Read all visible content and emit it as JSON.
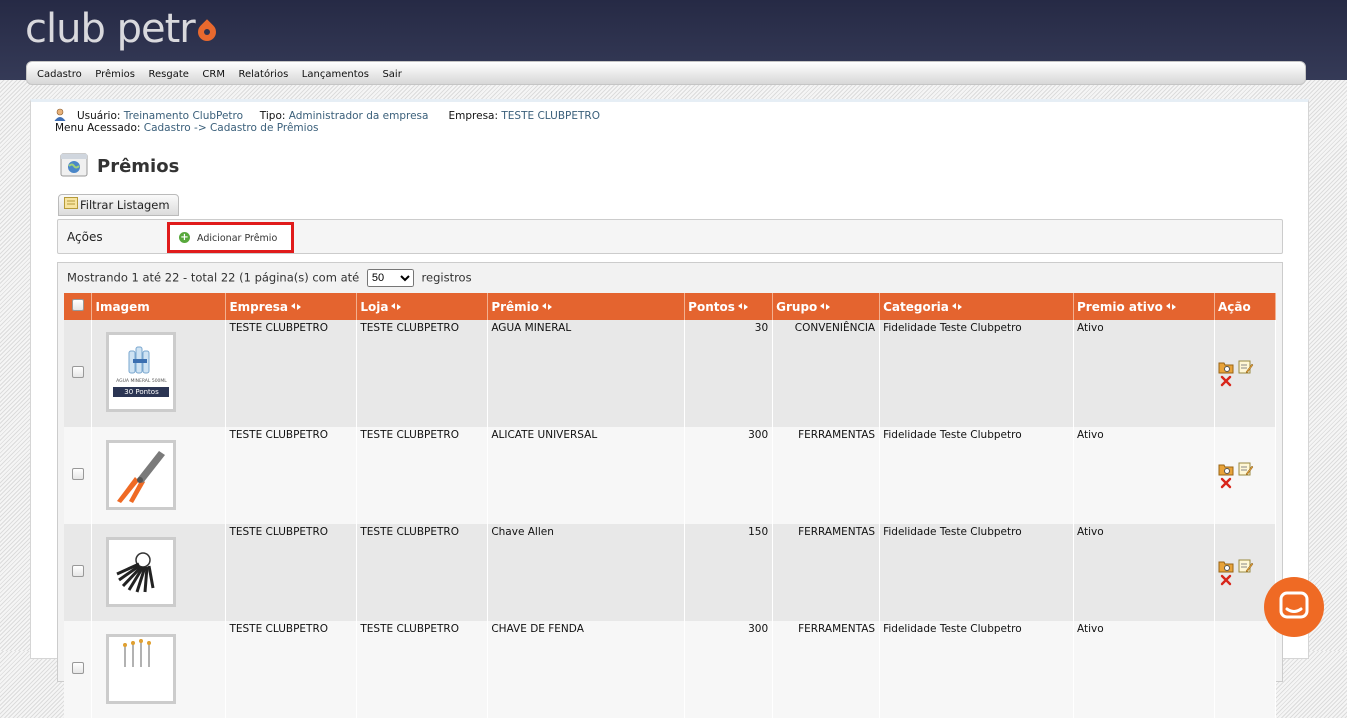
{
  "logo": {
    "text": "club petr"
  },
  "menu": [
    {
      "label": "Cadastro"
    },
    {
      "label": "Prêmios"
    },
    {
      "label": "Resgate"
    },
    {
      "label": "CRM"
    },
    {
      "label": "Relatórios"
    },
    {
      "label": "Lançamentos"
    },
    {
      "label": "Sair"
    }
  ],
  "userinfo": {
    "usuario_label": "Usuário:",
    "usuario": "Treinamento ClubPetro",
    "tipo_label": "Tipo:",
    "tipo": "Administrador da empresa",
    "empresa_label": "Empresa:",
    "empresa": "TESTE CLUBPETRO",
    "menu_label": "Menu Acessado:",
    "menu_path": "Cadastro -> Cadastro de Prêmios"
  },
  "page": {
    "title": "Prêmios",
    "filter_button": "Filtrar Listagem",
    "actions_label": "Ações",
    "add_button": "Adicionar Prêmio"
  },
  "listing": {
    "showing_text": "Mostrando 1 até 22 - total 22 (1 página(s) com até",
    "page_size": "50",
    "suffix": "registros"
  },
  "table": {
    "headers": {
      "imagem": "Imagem",
      "empresa": "Empresa",
      "loja": "Loja",
      "premio": "Prêmio",
      "pontos": "Pontos",
      "grupo": "Grupo",
      "categoria": "Categoria",
      "ativo": "Premio ativo",
      "acao": "Ação"
    },
    "rows": [
      {
        "empresa": "TESTE CLUBPETRO",
        "loja": "TESTE CLUBPETRO",
        "premio": "AGUA MINERAL",
        "pontos": "30",
        "grupo": "CONVENIÊNCIA",
        "categoria": "Fidelidade Teste Clubpetro",
        "ativo": "Ativo",
        "thumb_caption": "AGUA MINERAL 500ML",
        "thumb_badge": "30 Pontos"
      },
      {
        "empresa": "TESTE CLUBPETRO",
        "loja": "TESTE CLUBPETRO",
        "premio": "ALICATE UNIVERSAL",
        "pontos": "300",
        "grupo": "FERRAMENTAS",
        "categoria": "Fidelidade Teste Clubpetro",
        "ativo": "Ativo"
      },
      {
        "empresa": "TESTE CLUBPETRO",
        "loja": "TESTE CLUBPETRO",
        "premio": "Chave Allen",
        "pontos": "150",
        "grupo": "FERRAMENTAS",
        "categoria": "Fidelidade Teste Clubpetro",
        "ativo": "Ativo"
      },
      {
        "empresa": "TESTE CLUBPETRO",
        "loja": "TESTE CLUBPETRO",
        "premio": "CHAVE DE FENDA",
        "pontos": "300",
        "grupo": "FERRAMENTAS",
        "categoria": "Fidelidade Teste Clubpetro",
        "ativo": "Ativo"
      }
    ]
  },
  "icons": {
    "user": "user-icon",
    "title": "globe-window-icon",
    "add": "plus-circle-icon",
    "view": "folder-view-icon",
    "edit": "edit-icon",
    "delete": "delete-icon",
    "sort": "sort-icon",
    "chat": "chat-icon"
  },
  "colors": {
    "header_bg": "#2e3350",
    "accent": "#e4642f",
    "highlight": "#e01b1b"
  }
}
